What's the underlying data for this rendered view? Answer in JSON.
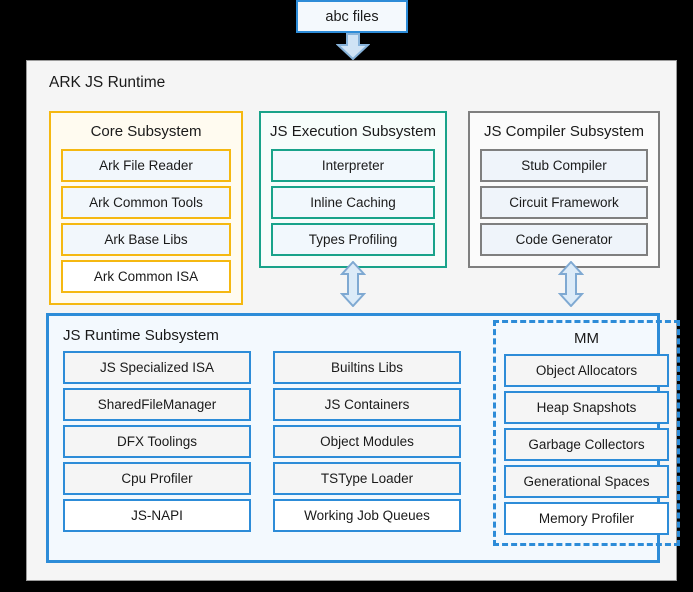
{
  "input": {
    "label": "abc files",
    "arrow_icon": "arrow-down-icon"
  },
  "runtime": {
    "title": "ARK JS Runtime"
  },
  "connectors": {
    "execution_arrow_icon": "double-arrow-vertical-icon",
    "compiler_arrow_icon": "double-arrow-vertical-icon"
  },
  "subsystems": {
    "core": {
      "title": "Core Subsystem",
      "accent": "#f5b811",
      "items": [
        "Ark File Reader",
        "Ark Common Tools",
        "Ark Base Libs",
        "Ark Common ISA"
      ]
    },
    "js_execution": {
      "title": "JS Execution Subsystem",
      "accent": "#19a38a",
      "items": [
        "Interpreter",
        "Inline Caching",
        "Types Profiling"
      ]
    },
    "js_compiler": {
      "title": "JS Compiler Subsystem",
      "accent": "#7f7f7f",
      "items": [
        "Stub Compiler",
        "Circuit Framework",
        "Code Generator"
      ]
    },
    "js_runtime": {
      "title": "JS Runtime Subsystem",
      "accent": "#2d8cd8",
      "column_1": [
        "JS Specialized ISA",
        "SharedFileManager",
        "DFX Toolings",
        "Cpu Profiler",
        "JS-NAPI"
      ],
      "column_2": [
        "Builtins Libs",
        "JS Containers",
        "Object Modules",
        "TSType Loader",
        "Working Job Queues"
      ],
      "mm": {
        "title": "MM",
        "items": [
          "Object Allocators",
          "Heap Snapshots",
          "Garbage Collectors",
          "Generational Spaces",
          "Memory Profiler"
        ]
      }
    }
  }
}
